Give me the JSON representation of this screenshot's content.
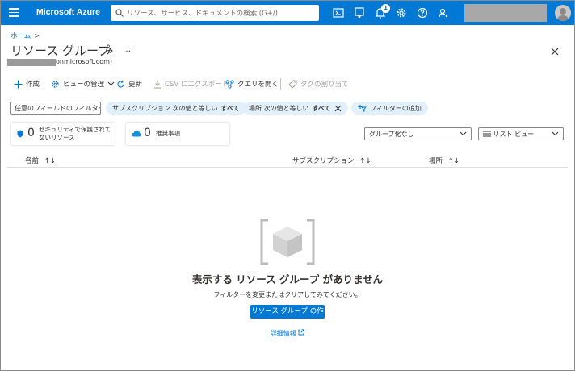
{
  "topbar": {
    "brand": "Microsoft Azure",
    "search_placeholder": "リソース、サービス、ドキュメントの検索 (G+/)",
    "notification_count": "1"
  },
  "header": {
    "breadcrumb": "ホーム",
    "breadcrumb_sep": ">",
    "title": "リソース グループ",
    "more": "…",
    "tenant_suffix": "onmicrosoft.com)"
  },
  "commands": {
    "create": "作成",
    "view_manage": "ビューの管理",
    "refresh": "更新",
    "csv_export": "CSV にエクスポート",
    "open_query": "クエリを開く",
    "assign_tags": "タグの割り当て"
  },
  "filters": {
    "field_filter": "任意のフィールドのフィルター...",
    "subscription_filter_label": "サブスクリプション 次の値と等しい",
    "subscription_filter_value": "すべて",
    "location_filter_label": "場所 次の値と等しい",
    "location_filter_value": "すべて",
    "add_filter": "フィルターの追加"
  },
  "summary": {
    "unprotected_count": "0",
    "unprotected_label_1": "セキュリティで保護されてい",
    "unprotected_label_2": "ないリソース",
    "recommendations_count": "0",
    "recommendations_label": "推奨事項"
  },
  "view_controls": {
    "grouping": "グループ化なし",
    "view_mode": "リスト ビュー"
  },
  "table": {
    "columns": [
      "名前",
      "サブスクリプション",
      "場所"
    ]
  },
  "empty_state": {
    "title": "表示する リソース グループ がありません",
    "description": "フィルターを変更またはクリアしてみてください。",
    "create_button": "リソース グループ の作成",
    "learn_more": "詳細情報"
  },
  "colors": {
    "accent": "#0078d4",
    "pill_bg": "#e1f0fa"
  }
}
